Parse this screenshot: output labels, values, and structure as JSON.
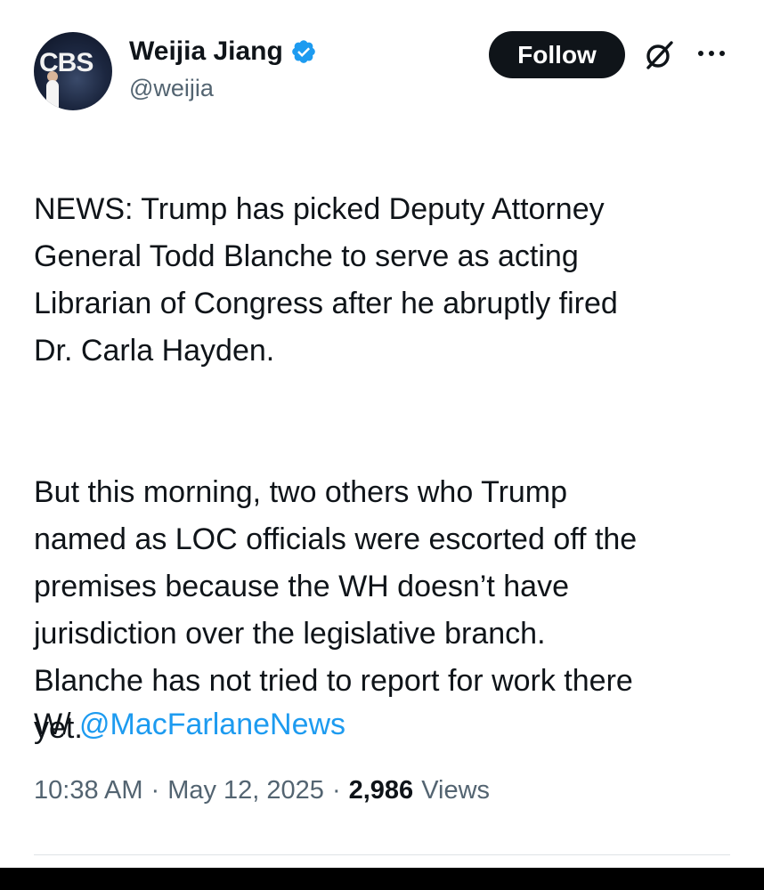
{
  "author": {
    "display_name": "Weijia Jiang",
    "handle": "@weijia",
    "verified": true,
    "avatar_logo_text": "CBS"
  },
  "actions": {
    "follow_label": "Follow",
    "grok_icon": "grok-slash-icon",
    "more_icon": "more-dots-icon"
  },
  "tweet": {
    "paragraphs": [
      "NEWS: Trump has picked Deputy Attorney\nGeneral Todd Blanche to serve as acting\nLibrarian of Congress after he abruptly fired\nDr. Carla Hayden.",
      "But this morning, two others who Trump\nnamed as LOC officials were escorted off the\npremises because the WH doesn’t have\njurisdiction over the legislative branch.\nBlanche has not tried to report for work there\nyet."
    ],
    "mention_prefix": "W/",
    "mention": "@MacFarlaneNews"
  },
  "meta": {
    "time": "10:38 AM",
    "separator": "·",
    "date": "May 12, 2025",
    "views_count": "2,986",
    "views_label": "Views"
  },
  "colors": {
    "text": "#0f1419",
    "secondary": "#536471",
    "link": "#1d9bf0",
    "verified": "#1d9bf0",
    "button_bg": "#0f1419"
  }
}
